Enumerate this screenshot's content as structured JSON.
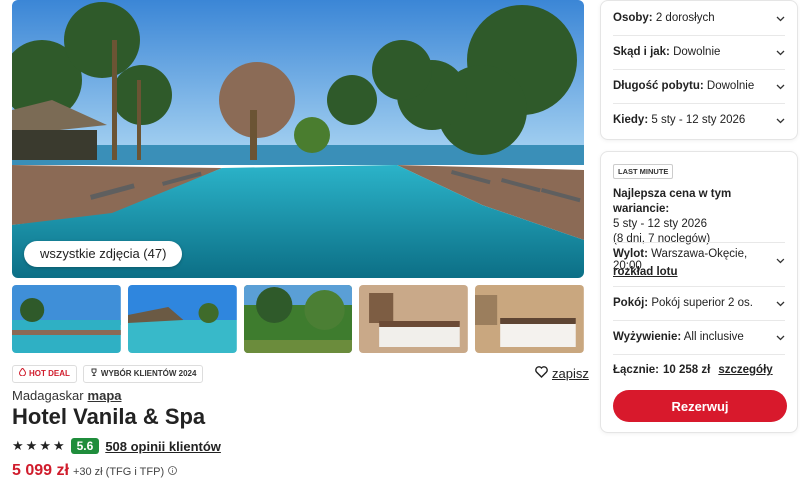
{
  "gallery": {
    "all_photos_label": "wszystkie zdjęcia (47)"
  },
  "badges": {
    "hot_deal": "HOT DEAL",
    "award": "WYBÓR KLIENTÓW 2024"
  },
  "save_label": "zapisz",
  "hotel": {
    "country": "Madagaskar",
    "map_link": "mapa",
    "name": "Hotel Vanila & Spa",
    "stars": 4,
    "score": "5.6",
    "reviews": "508 opinii klientów",
    "price": "5 099 zł",
    "price_extra": "+30 zł (TFG i TFP)"
  },
  "search": [
    {
      "key": "Osoby:",
      "value": "2 dorosłych"
    },
    {
      "key": "Skąd i jak:",
      "value": "Dowolnie"
    },
    {
      "key": "Długość pobytu:",
      "value": "Dowolnie"
    },
    {
      "key": "Kiedy:",
      "value": "5 sty - 12 sty 2026"
    }
  ],
  "offer": {
    "tag": "LAST MINUTE",
    "best_title": "Najlepsza cena w tym wariancie:",
    "dates": "5 sty - 12 sty 2026",
    "nights": "(8 dni, 7 noclegów)",
    "flight_key": "Wylot:",
    "flight_value": "Warszawa-Okęcie, 20:00",
    "flight_schedule": "rozkład lotu",
    "room_key": "Pokój:",
    "room_value": "Pokój superior 2 os.",
    "board_key": "Wyżywienie:",
    "board_value": "All inclusive",
    "total_key": "Łącznie:",
    "total_value": "10 258 zł",
    "details_link": "szczegóły",
    "reserve_label": "Rezerwuj"
  },
  "colors": {
    "accent": "#d8192c",
    "score_bg": "#1f8d3c"
  }
}
